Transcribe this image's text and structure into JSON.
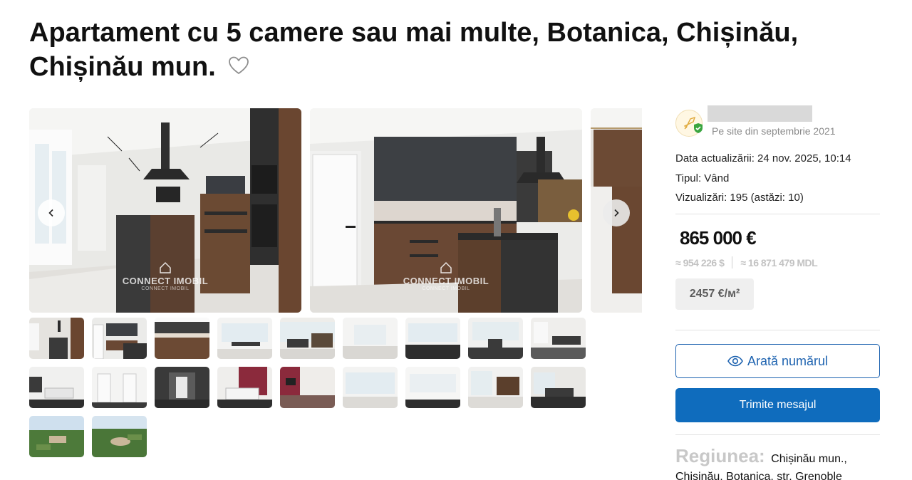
{
  "page": {
    "title": "Apartament cu 5 camere sau mai multe, Botanica, Chișinău, Chișinău mun."
  },
  "gallery": {
    "watermark": "CONNECT IMOBIL",
    "watermark_sub": "CONNECT IMOBIL",
    "prev_icon": "chevron-left-icon",
    "next_icon": "chevron-right-icon",
    "thumbnail_count": 20
  },
  "seller": {
    "since": "Pe site din septembrie 2021"
  },
  "details": {
    "updated": "Data actualizării: 24 nov. 2025, 10:14",
    "type": "Tipul: Vând",
    "views": "Vizualizări: 195 (astăzi: 10)"
  },
  "price": {
    "main": "865 000 €",
    "usd": "≈ 954 226 $",
    "mdl": "≈ 16 871 479 MDL",
    "per_sqm": "2457 €/м²"
  },
  "actions": {
    "show_number": "Arată numărul",
    "send_message": "Trimite mesajul"
  },
  "region": {
    "label": "Regiunea:",
    "value": "Chișinău mun., Chișinău, Botanica, str. Grenoble"
  },
  "colors": {
    "primary": "#0f6cbd",
    "outline": "#1e63b0",
    "muted": "#c2c2c2",
    "verified": "#3aa53f"
  }
}
